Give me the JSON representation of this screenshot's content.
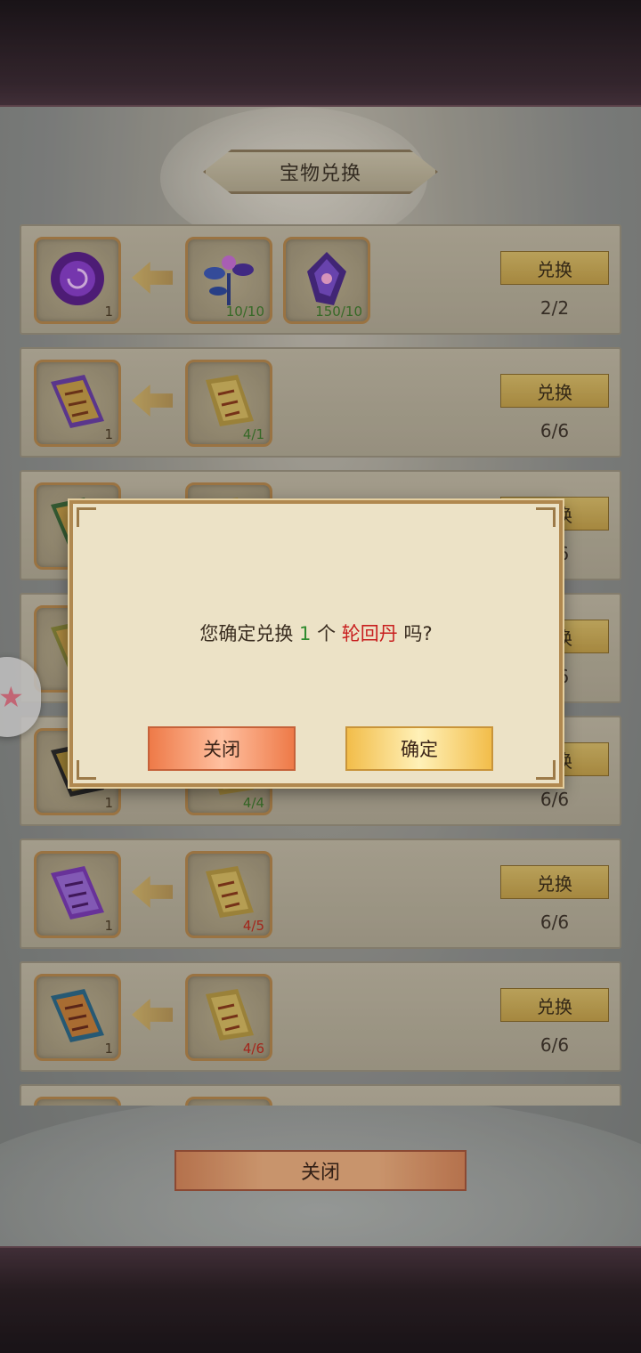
{
  "title": "宝物兑换",
  "rows": [
    {
      "reward": {
        "icon": "purple-orb-icon",
        "qty": "1"
      },
      "costs": [
        {
          "icon": "blue-flower-icon",
          "qty": "10/10",
          "status": "ok"
        },
        {
          "icon": "purple-crystal-icon",
          "qty": "150/10",
          "status": "ok"
        }
      ],
      "button": "兑换",
      "count": "2/2"
    },
    {
      "reward": {
        "icon": "purple-scroll-icon",
        "qty": "1"
      },
      "costs": [
        {
          "icon": "gold-scroll-icon",
          "qty": "4/1",
          "status": "ok"
        }
      ],
      "button": "兑换",
      "count": "6/6"
    },
    {
      "reward": {
        "icon": "green-scroll-icon",
        "qty": ""
      },
      "costs": [
        {
          "icon": "gold-scroll-icon",
          "qty": "",
          "status": "ok"
        }
      ],
      "button": "兑换",
      "count": "6/6"
    },
    {
      "reward": {
        "icon": "yellow-scroll-icon",
        "qty": ""
      },
      "costs": [
        {
          "icon": "gold-scroll-icon",
          "qty": "",
          "status": "ok"
        }
      ],
      "button": "兑换",
      "count": "6/6"
    },
    {
      "reward": {
        "icon": "dark-scroll-icon",
        "qty": "1"
      },
      "costs": [
        {
          "icon": "gold-scroll-icon",
          "qty": "4/4",
          "status": "ok"
        }
      ],
      "button": "兑换",
      "count": "6/6"
    },
    {
      "reward": {
        "icon": "violet-scroll-icon",
        "qty": "1"
      },
      "costs": [
        {
          "icon": "gold-scroll-icon",
          "qty": "4/5",
          "status": "bad"
        }
      ],
      "button": "兑换",
      "count": "6/6"
    },
    {
      "reward": {
        "icon": "teal-scroll-icon",
        "qty": "1"
      },
      "costs": [
        {
          "icon": "gold-scroll-icon",
          "qty": "4/6",
          "status": "bad"
        }
      ],
      "button": "兑换",
      "count": "6/6"
    }
  ],
  "close_label": "关闭",
  "dialog": {
    "msg_prefix": "您确定兑换",
    "msg_num": "1",
    "msg_unit": "个",
    "msg_item": "轮回丹",
    "msg_suffix": "吗?",
    "close_label": "关闭",
    "confirm_label": "确定"
  },
  "colors": {
    "ok_qty": "#3d7d2c",
    "bad_qty": "#c22a1e",
    "item_highlight": "#c81e1e",
    "num_highlight": "#2e8b2e"
  }
}
